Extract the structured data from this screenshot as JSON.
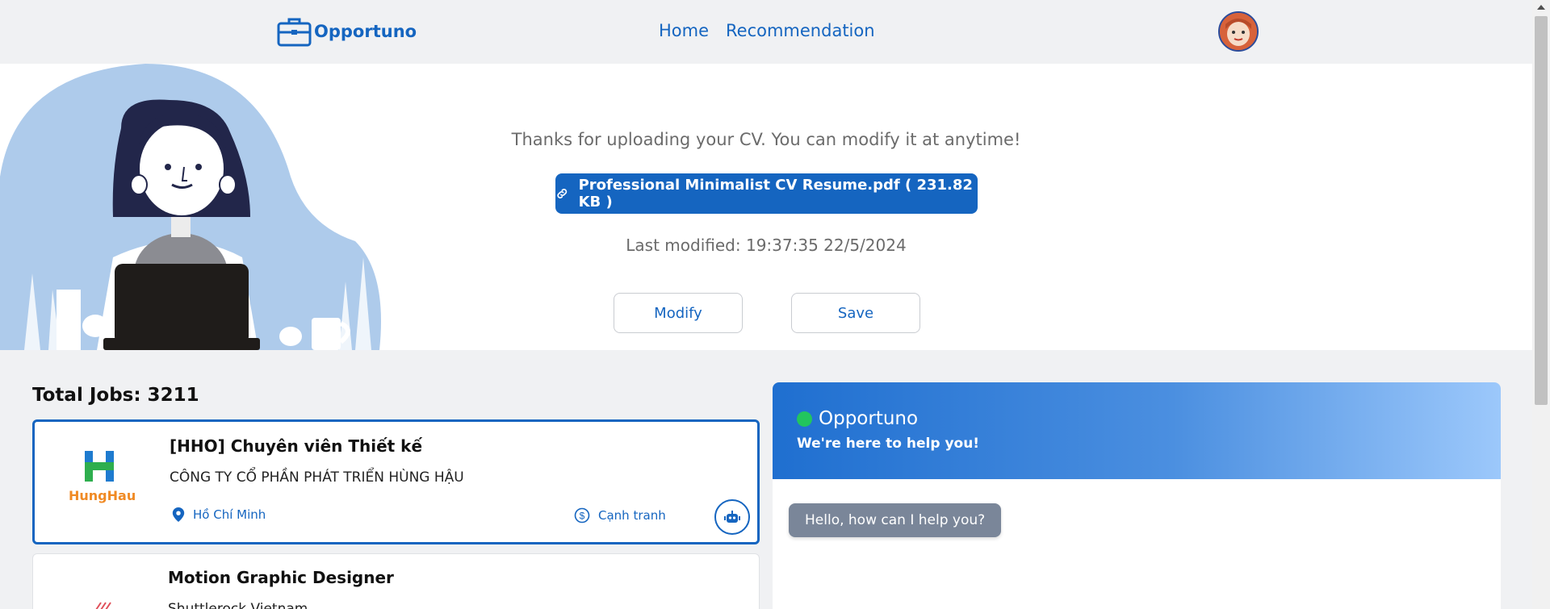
{
  "header": {
    "brand": "Opportuno",
    "nav": [
      {
        "label": "Home"
      },
      {
        "label": "Recommendation"
      }
    ]
  },
  "hero": {
    "message": "Thanks for uploading your CV. You can modify it at anytime!",
    "cv_file": "Professional Minimalist CV Resume.pdf ( 231.82 KB )",
    "last_modified": "Last modified: 19:37:35 22/5/2024",
    "modify_label": "Modify",
    "save_label": "Save"
  },
  "jobs": {
    "total_label": "Total Jobs: 3211",
    "items": [
      {
        "title": "[HHO] Chuyên viên Thiết kế",
        "company": "CÔNG TY CỔ PHẦN PHÁT TRIỂN HÙNG HẬU",
        "location": "Hồ Chí Minh",
        "salary": "Cạnh tranh",
        "logo_text": "HungHau"
      },
      {
        "title": "Motion Graphic Designer",
        "company": "Shuttlerock Vietnam"
      }
    ]
  },
  "chat": {
    "name": "Opportuno",
    "subtitle": "We're here to help you!",
    "greeting": "Hello, how can I help you?"
  },
  "colors": {
    "primary": "#1565c0",
    "online": "#22c55e",
    "page_bg": "#f0f1f3"
  },
  "icons": [
    "briefcase-icon",
    "link-icon",
    "location-pin-icon",
    "dollar-circle-icon",
    "robot-icon"
  ]
}
